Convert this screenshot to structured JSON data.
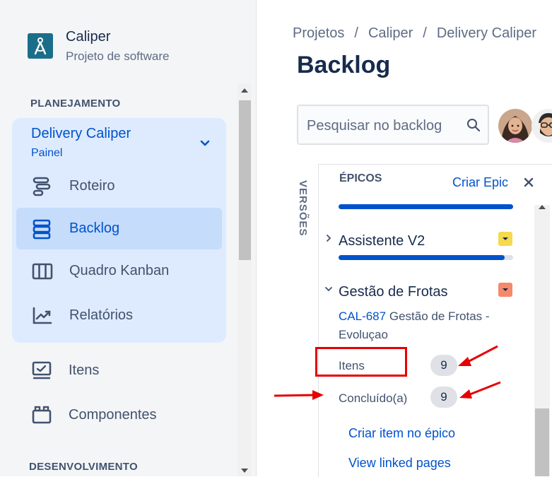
{
  "project": {
    "name": "Caliper",
    "type": "Projeto de software",
    "brand_color": "#1b6e8a"
  },
  "sidebar": {
    "section_planning": "PLANEJAMENTO",
    "section_development": "DESENVOLVIMENTO",
    "board": {
      "name": "Delivery Caliper",
      "subtitle": "Painel"
    },
    "items": [
      {
        "label": "Roteiro",
        "icon": "roadmap-icon",
        "active": false
      },
      {
        "label": "Backlog",
        "icon": "backlog-icon",
        "active": true
      },
      {
        "label": "Quadro Kanban",
        "icon": "kanban-board-icon",
        "active": false
      },
      {
        "label": "Relatórios",
        "icon": "reports-icon",
        "active": false
      },
      {
        "label": "Itens",
        "icon": "issues-icon",
        "active": false
      },
      {
        "label": "Componentes",
        "icon": "components-icon",
        "active": false
      }
    ]
  },
  "header": {
    "breadcrumb": [
      "Projetos",
      "Caliper",
      "Delivery Caliper"
    ],
    "breadcrumb_separator": "/",
    "title": "Backlog"
  },
  "search": {
    "placeholder": "Pesquisar no backlog"
  },
  "versions_tab": "VERSÕES",
  "epics": {
    "title": "ÉPICOS",
    "create_label": "Criar Epic",
    "list": [
      {
        "name": "Assistente V2",
        "expanded": false,
        "color": "#f5d94e",
        "progress": 0.95
      },
      {
        "name": "Gestão de Frotas",
        "expanded": true,
        "color": "#f4896b",
        "issue_key": "CAL-687",
        "issue_summary": "Gestão de Frotas - Evoluçao",
        "stats": [
          {
            "label": "Itens",
            "value": "9"
          },
          {
            "label": "Concluído(a)",
            "value": "9"
          }
        ],
        "actions": [
          "Criar item no épico",
          "View linked pages"
        ]
      }
    ]
  },
  "colors": {
    "accent": "#0052cc",
    "annotation": "#e60000",
    "active_bg": "#c6dcfb",
    "group_bg": "#deebff"
  }
}
